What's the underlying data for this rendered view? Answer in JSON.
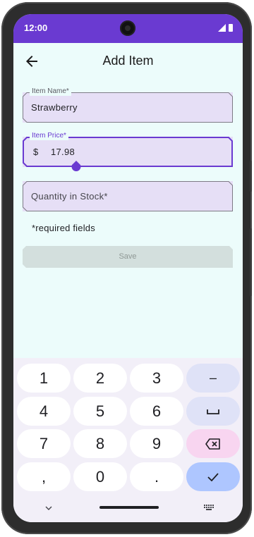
{
  "status_bar": {
    "time": "12:00"
  },
  "app_bar": {
    "title": "Add Item"
  },
  "form": {
    "item_name": {
      "label": "Item Name*",
      "value": "Strawberry"
    },
    "item_price": {
      "label": "Item Price*",
      "prefix": "$",
      "value": "17.98"
    },
    "quantity": {
      "placeholder": "Quantity in Stock*"
    },
    "required_note": "*required fields",
    "save_label": "Save"
  },
  "keyboard": {
    "rows": [
      [
        "1",
        "2",
        "3",
        "–"
      ],
      [
        "4",
        "5",
        "6",
        "space"
      ],
      [
        "7",
        "8",
        "9",
        "backspace"
      ],
      [
        ",",
        "0",
        ".",
        "done"
      ]
    ],
    "keys": {
      "k1": "1",
      "k2": "2",
      "k3": "3",
      "minus": "–",
      "k4": "4",
      "k5": "5",
      "k6": "6",
      "k7": "7",
      "k8": "8",
      "k9": "9",
      "comma": ",",
      "k0": "0",
      "period": "."
    }
  },
  "colors": {
    "status_bar": "#6a3ad1",
    "background": "#ecfcfb",
    "field_fill": "#e6dff6",
    "focused_outline": "#6a3ad1",
    "save_disabled": "#d3dfdd",
    "done_key": "#aec6ff",
    "backspace_key": "#f8d5f0"
  }
}
